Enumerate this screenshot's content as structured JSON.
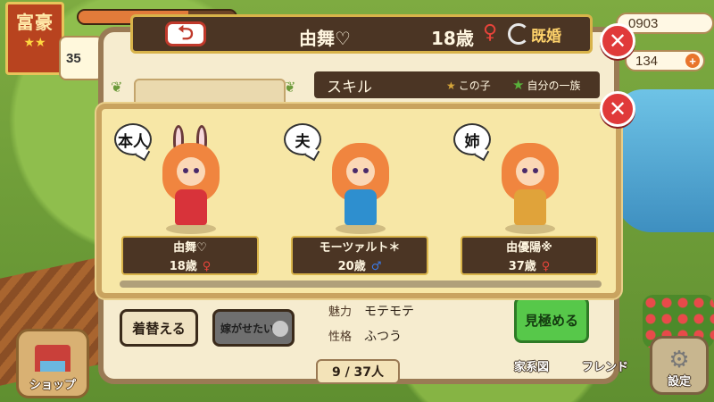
{
  "hud": {
    "rank_label": "富豪",
    "rank_stars": "★★",
    "xp_fraction": 0.7,
    "side_value": "35",
    "coins": "0903",
    "gems": "134",
    "gem_plus": "+"
  },
  "profile": {
    "back_icon": "undo-arrow-icon",
    "name": "由舞♡",
    "age": "18歳",
    "gender_symbol": "♀",
    "marital_status": "既婚",
    "skill_title": "スキル",
    "skill_legend_child": "この子",
    "skill_legend_family": "自分の一族",
    "dress_up_label": "着替える",
    "marry_label": "嫁がせたい",
    "stats": [
      {
        "key": "魅力",
        "value": "モテモテ"
      },
      {
        "key": "性格",
        "value": "ふつう"
      }
    ],
    "judge_label": "見極める",
    "page_counter": "9 / 37人"
  },
  "family_popup": {
    "close_icon": "close-x-icon",
    "members": [
      {
        "relation": "本人",
        "name": "由舞♡",
        "age": "18歳",
        "gender_symbol": "♀",
        "gender": "female",
        "outfit_color": "#d8333a"
      },
      {
        "relation": "夫",
        "name": "モーツァルト＊",
        "age": "20歳",
        "gender_symbol": "♂",
        "gender": "male",
        "outfit_color": "#2e8fcf"
      },
      {
        "relation": "姉",
        "name": "由優陽※",
        "age": "37歳",
        "gender_symbol": "♀",
        "gender": "female",
        "outfit_color": "#e0a33a"
      }
    ]
  },
  "bottom_bar": {
    "shop_label": "ショップ",
    "family_tree_label": "家系図",
    "friend_label": "フレンド",
    "settings_label": "設定"
  },
  "colors": {
    "panel_bg": "#f6eccf",
    "popup_bg": "#f7e7a6",
    "header_bg": "#4b3524",
    "accent_gold": "#d8b34a",
    "close_red": "#e03a3a",
    "female": "#e8443a",
    "male": "#3a7ae8",
    "judge_green": "#57c84a"
  }
}
